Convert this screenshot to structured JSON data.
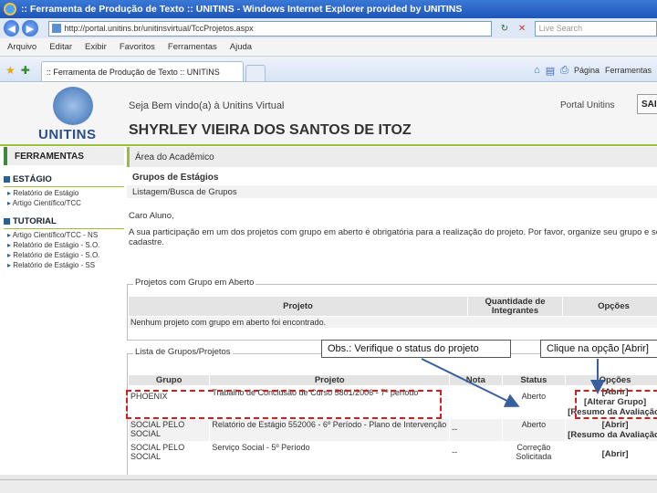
{
  "browser": {
    "window_title": ":: Ferramenta de Produção de Texto :: UNITINS - Windows Internet Explorer provided by UNITINS",
    "address": "http://portal.unitins.br/unitinsvirtual/TccProjetos.aspx",
    "search_placeholder": "Live Search",
    "menu": [
      "Arquivo",
      "Editar",
      "Exibir",
      "Favoritos",
      "Ferramentas",
      "Ajuda"
    ],
    "tab_title": ":: Ferramenta de Produção de Texto :: UNITINS",
    "page_menu": "Página",
    "tools_menu": "Ferramentas"
  },
  "header": {
    "logo_text": "UNITINS",
    "welcome": "Seja Bem vindo(a) à Unitins Virtual",
    "portal_link": "Portal Unitins",
    "exit_button": "SAIR",
    "user_name": "SHYRLEY VIEIRA DOS SANTOS DE ITOZ"
  },
  "sidebar": {
    "title": "FERRAMENTAS",
    "sections": [
      {
        "title": "ESTÁGIO",
        "items": [
          "Relatório de Estágio",
          "Artigo Científico/TCC"
        ]
      },
      {
        "title": "TUTORIAL",
        "items": [
          "Artigo Científico/TCC - NS",
          "Relatório de Estágio - S.O.",
          "Relatório de Estágio - S.O.",
          "Relatório de Estágio - SS"
        ]
      }
    ]
  },
  "content": {
    "area": "Área do Acadêmico",
    "groups_title": "Grupos de Estágios",
    "groups_sub": "Listagem/Busca de Grupos",
    "greeting": "Caro Aluno,",
    "message": "A sua participação em um dos projetos com grupo em aberto é obrigatória para a realização do projeto. Por favor, organize seu grupo e se cadastre.",
    "open_projects": {
      "legend": "Projetos com Grupo em Aberto",
      "headers": [
        "Projeto",
        "Quantidade de Integrantes",
        "Opções"
      ],
      "empty": "Nenhum projeto com grupo em aberto foi encontrado."
    },
    "groups_list": {
      "legend": "Lista de Grupos/Projetos",
      "headers": [
        "Grupo",
        "Projeto",
        "Nota",
        "Status",
        "Opções"
      ],
      "rows": [
        {
          "group": "PHOENIX",
          "project": "Trabalho de Conclusão de Curso 5801/2006 - 7º período",
          "grade": "",
          "status": "Aberto",
          "options": [
            "[Abrir]",
            "[Alterar Grupo]",
            "[Resumo da Avaliação]"
          ]
        },
        {
          "group": "SOCIAL PELO SOCIAL",
          "project": "Relatório de Estágio 552006 - 6º Período - Plano de Intervenção",
          "grade": "--",
          "status": "Aberto",
          "options": [
            "[Abrir]",
            "[Resumo da Avaliação]"
          ]
        },
        {
          "group": "SOCIAL PELO SOCIAL",
          "project": "Serviço Social - 5º Período",
          "grade": "--",
          "status": "Correção Solicitada",
          "options": [
            "[Abrir]"
          ]
        }
      ]
    }
  },
  "annotations": {
    "callout_status": "Obs.: Verifique o status do projeto",
    "callout_option": "Clique na opção [Abrir]"
  },
  "colors": {
    "title_blue": "#1f56b8",
    "accent_green": "#9bbf3b",
    "annotation_red": "#d02020",
    "arrow_blue": "#3a5f9e"
  }
}
